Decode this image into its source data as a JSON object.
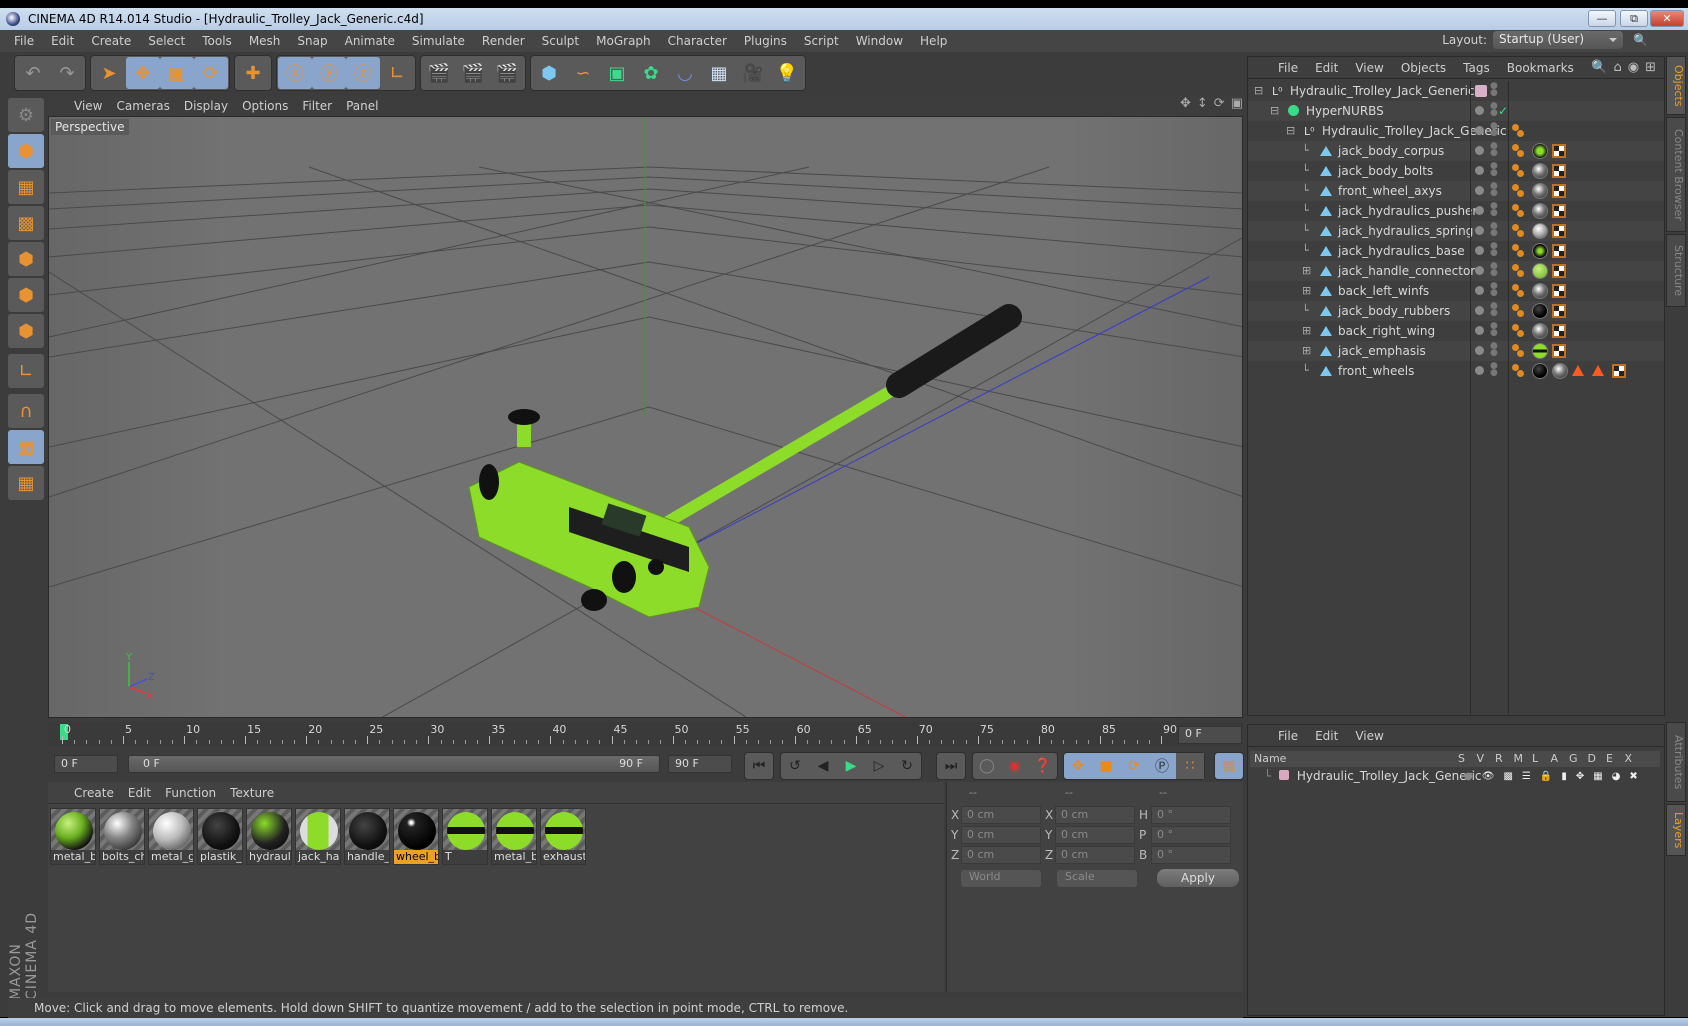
{
  "window": {
    "title": "CINEMA 4D R14.014 Studio - [Hydraulic_Trolley_Jack_Generic.c4d]",
    "buttons": [
      "minimize",
      "restore",
      "close"
    ]
  },
  "menubar": [
    "File",
    "Edit",
    "Create",
    "Select",
    "Tools",
    "Mesh",
    "Snap",
    "Animate",
    "Simulate",
    "Render",
    "Sculpt",
    "MoGraph",
    "Character",
    "Plugins",
    "Script",
    "Window",
    "Help"
  ],
  "layout": {
    "label": "Layout:",
    "value": "Startup (User)"
  },
  "toolbar": {
    "groups": [
      [
        "undo-icon",
        "redo-icon"
      ],
      [
        "live-selection-icon",
        "move-icon",
        "scale-icon",
        "rotate-icon"
      ],
      [
        "recent-tool-icon"
      ],
      [
        "x-axis-lock-icon",
        "y-axis-lock-icon",
        "z-axis-lock-icon",
        "coordinate-system-icon"
      ],
      [
        "render-view-icon",
        "render-picture-viewer-icon",
        "render-settings-icon"
      ],
      [
        "cube-icon",
        "spline-pen-icon",
        "subdivision-surface-icon",
        "array-icon",
        "deformer-bend-icon",
        "floor-icon",
        "camera-icon",
        "light-icon"
      ]
    ]
  },
  "left_tools": [
    "make-editable-icon",
    "model-mode-icon",
    "texture-mode-icon",
    "workplane-mode-icon",
    "points-mode-icon",
    "edges-mode-icon",
    "polygons-mode-icon",
    "axis-mode-icon",
    "snap-magnet-icon",
    "locked-workplane-icon",
    "workplane-rotate-icon"
  ],
  "branding": "MAXON CINEMA 4D",
  "viewport": {
    "menu": [
      "View",
      "Cameras",
      "Display",
      "Options",
      "Filter",
      "Panel"
    ],
    "label": "Perspective",
    "nav_icons": [
      "pan-icon",
      "dolly-icon",
      "orbit-icon",
      "maximize-view-icon"
    ],
    "axis_labels": [
      "Y",
      "Z",
      "X"
    ]
  },
  "timeline": {
    "ticks": [
      "0",
      "5",
      "10",
      "15",
      "20",
      "25",
      "30",
      "35",
      "40",
      "45",
      "50",
      "55",
      "60",
      "65",
      "70",
      "75",
      "80",
      "85",
      "90"
    ],
    "current_frame": "0 F",
    "start_field": "0 F",
    "range_start": "0 F",
    "range_end": "90 F",
    "end_field": "90 F"
  },
  "transport": {
    "buttons": [
      "go-to-start-icon",
      "go-to-previous-key-icon",
      "step-back-icon",
      "play-icon",
      "step-forward-icon",
      "go-to-next-key-icon",
      "go-to-end-icon"
    ],
    "record": [
      "motion-record-icon",
      "record-active-objects-icon",
      "autokeying-icon"
    ],
    "key_tracks": [
      "position-key-icon",
      "scale-key-icon",
      "rotation-key-icon",
      "parameter-key-icon",
      "point-level-icon"
    ],
    "timeline_button": "timeline-icon"
  },
  "materials": {
    "menu": [
      "Create",
      "Edit",
      "Function",
      "Texture"
    ],
    "items": [
      {
        "label": "metal_b",
        "style": "green-black"
      },
      {
        "label": "bolts_ch",
        "style": "chrome"
      },
      {
        "label": "metal_g",
        "style": "chrome-light"
      },
      {
        "label": "plastik_l",
        "style": "black"
      },
      {
        "label": "hydrauli",
        "style": "green-black-dark"
      },
      {
        "label": "jack_har",
        "style": "green-white"
      },
      {
        "label": "handle_",
        "style": "black"
      },
      {
        "label": "wheel_b",
        "style": "black-glossy",
        "selected": true
      },
      {
        "label": "T",
        "style": "green-stripe"
      },
      {
        "label": "metal_b",
        "style": "green-stripe"
      },
      {
        "label": "exhaust",
        "style": "green-stripe"
      }
    ]
  },
  "coordinates": {
    "headers": [
      "--",
      "--",
      "--"
    ],
    "rows": [
      {
        "l1": "X",
        "v1": "0 cm",
        "l2": "X",
        "v2": "0 cm",
        "l3": "H",
        "v3": "0 °"
      },
      {
        "l1": "Y",
        "v1": "0 cm",
        "l2": "Y",
        "v2": "0 cm",
        "l3": "P",
        "v3": "0 °"
      },
      {
        "l1": "Z",
        "v1": "0 cm",
        "l2": "Z",
        "v2": "0 cm",
        "l3": "B",
        "v3": "0 °"
      }
    ],
    "space_dropdown": "World",
    "mode_dropdown": "Scale",
    "apply_label": "Apply"
  },
  "status": "Move: Click and drag to move elements. Hold down SHIFT to quantize movement / add to the selection in point mode, CTRL to remove.",
  "objects": {
    "menu": [
      "File",
      "Edit",
      "View",
      "Objects",
      "Tags",
      "Bookmarks"
    ],
    "tree": [
      {
        "name": "Hydraulic_Trolley_Jack_Generic",
        "type": "null",
        "depth": 0,
        "expand": "minus",
        "tags": []
      },
      {
        "name": "HyperNURBS",
        "type": "hypernurbs",
        "depth": 1,
        "expand": "minus",
        "tags": []
      },
      {
        "name": "Hydraulic_Trolley_Jack_Generic",
        "type": "null",
        "depth": 2,
        "expand": "minus",
        "tags": [
          "phong"
        ]
      },
      {
        "name": "jack_body_corpus",
        "type": "polygon",
        "depth": 3,
        "expand": "none",
        "tags": [
          "phong",
          "mat-green-black",
          "texture"
        ]
      },
      {
        "name": "jack_body_bolts",
        "type": "polygon",
        "depth": 3,
        "expand": "none",
        "tags": [
          "phong",
          "mat-chrome",
          "texture"
        ]
      },
      {
        "name": "front_wheel_axys",
        "type": "polygon",
        "depth": 3,
        "expand": "none",
        "tags": [
          "phong",
          "mat-chrome",
          "texture"
        ]
      },
      {
        "name": "jack_hydraulics_pusher",
        "type": "polygon",
        "depth": 3,
        "expand": "none",
        "tags": [
          "phong",
          "mat-chrome",
          "texture"
        ]
      },
      {
        "name": "jack_hydraulics_spring",
        "type": "polygon",
        "depth": 3,
        "expand": "none",
        "tags": [
          "phong",
          "mat-chrome-light",
          "texture"
        ]
      },
      {
        "name": "jack_hydraulics_base",
        "type": "polygon",
        "depth": 3,
        "expand": "none",
        "tags": [
          "phong",
          "mat-green-black-dark",
          "texture"
        ]
      },
      {
        "name": "jack_handle_connector",
        "type": "polygon",
        "depth": 3,
        "expand": "plus",
        "tags": [
          "phong",
          "mat-green",
          "texture"
        ]
      },
      {
        "name": "back_left_winfs",
        "type": "polygon",
        "depth": 3,
        "expand": "plus",
        "tags": [
          "phong",
          "mat-chrome",
          "texture"
        ]
      },
      {
        "name": "jack_body_rubbers",
        "type": "polygon",
        "depth": 3,
        "expand": "none",
        "tags": [
          "phong",
          "mat-black",
          "texture"
        ]
      },
      {
        "name": "back_right_wing",
        "type": "polygon",
        "depth": 3,
        "expand": "plus",
        "tags": [
          "phong",
          "mat-chrome",
          "texture"
        ]
      },
      {
        "name": "jack_emphasis",
        "type": "polygon",
        "depth": 3,
        "expand": "plus",
        "tags": [
          "phong",
          "mat-green-stripe",
          "texture"
        ]
      },
      {
        "name": "front_wheels",
        "type": "polygon",
        "depth": 3,
        "expand": "none",
        "tags": [
          "phong",
          "mat-black",
          "mat-chrome",
          "selection",
          "selection",
          "texture"
        ]
      }
    ]
  },
  "layers": {
    "menu": [
      "File",
      "Edit",
      "View"
    ],
    "columns": [
      "Name",
      "S",
      "V",
      "R",
      "M",
      "L",
      "A",
      "G",
      "D",
      "E",
      "X"
    ],
    "rows": [
      {
        "name": "Hydraulic_Trolley_Jack_Generic",
        "color": "#d8a8c0"
      }
    ]
  },
  "side_tabs_top": [
    {
      "label": "Objects",
      "active": true
    },
    {
      "label": "Content Browser",
      "active": false
    },
    {
      "label": "Structure",
      "active": false
    }
  ],
  "side_tabs_bottom": [
    {
      "label": "Attributes",
      "active": false
    },
    {
      "label": "Layers",
      "active": true
    }
  ],
  "colors": {
    "accent_orange": "#f0a020",
    "selection_blue": "#8aa5cc",
    "jack_green": "#8edc2a"
  }
}
